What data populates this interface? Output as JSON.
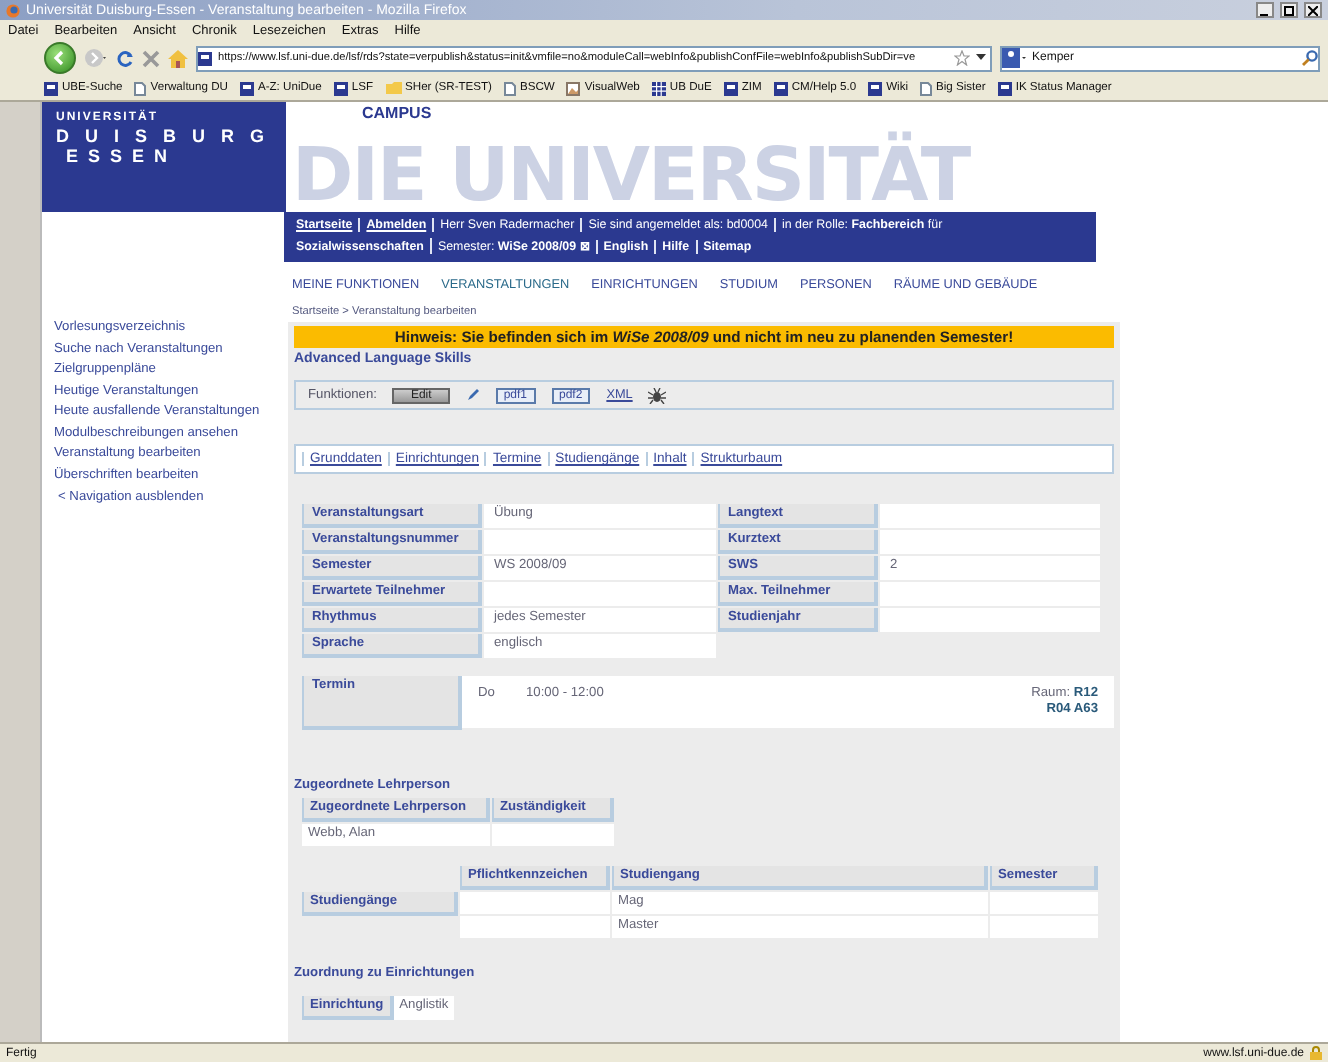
{
  "browser": {
    "title": "Universität Duisburg-Essen - Veranstaltung bearbeiten - Mozilla Firefox",
    "menu": [
      "Datei",
      "Bearbeiten",
      "Ansicht",
      "Chronik",
      "Lesezeichen",
      "Extras",
      "Hilfe"
    ],
    "url": "https://www.lsf.uni-due.de/lsf/rds?state=verpublish&status=init&vmfile=no&moduleCall=webInfo&publishConfFile=webInfo&publishSubDir=ve",
    "search_value": "Kemper",
    "bookmarks": [
      {
        "label": "UBE-Suche",
        "kind": "site"
      },
      {
        "label": "Verwaltung DU",
        "kind": "page"
      },
      {
        "label": "A-Z: UniDue",
        "kind": "site"
      },
      {
        "label": "LSF",
        "kind": "site"
      },
      {
        "label": "SHer (SR-TEST)",
        "kind": "folder"
      },
      {
        "label": "BSCW",
        "kind": "page"
      },
      {
        "label": "VisualWeb",
        "kind": "image"
      },
      {
        "label": "UB DuE",
        "kind": "grid"
      },
      {
        "label": "ZIM",
        "kind": "site"
      },
      {
        "label": "CM/Help 5.0",
        "kind": "site"
      },
      {
        "label": "Wiki",
        "kind": "site"
      },
      {
        "label": "Big Sister",
        "kind": "page"
      },
      {
        "label": "IK Status Manager",
        "kind": "site"
      }
    ]
  },
  "header": {
    "logo_top": "UNIVERSITÄT",
    "logo_city1": "DUISBURG",
    "logo_city2": "ESSEN",
    "watermark": "DIE UNIVERSITÄT",
    "portal": "CAMPUS"
  },
  "userbar": [
    [
      {
        "text": "Startseite",
        "kind": "link"
      },
      {
        "text": "Abmelden",
        "kind": "link"
      },
      {
        "text": "Herr Sven Radermacher",
        "kind": "text"
      },
      {
        "text": "Sie sind angemeldet als:    bd0004",
        "kind": "text"
      },
      {
        "text": "in der Rolle: **Fachbereich** für",
        "kind": "text"
      }
    ],
    [
      {
        "text": "Sozialwissenschaften",
        "kind": "bold"
      },
      {
        "text": "Semester:  **WiSe 2008/09 ⊠**",
        "kind": "text"
      },
      {
        "text": "English",
        "kind": "bold"
      },
      {
        "text": "Hilfe",
        "kind": "bold"
      },
      {
        "text": "Sitemap",
        "kind": "bold"
      }
    ]
  ],
  "main_nav": [
    {
      "label": "MEINE FUNKTIONEN",
      "selected": false
    },
    {
      "label": "VERANSTALTUNGEN",
      "selected": true
    },
    {
      "label": "EINRICHTUNGEN",
      "selected": false
    },
    {
      "label": "STUDIUM",
      "selected": false
    },
    {
      "label": "PERSONEN",
      "selected": false
    },
    {
      "label": "RÄUME UND GEBÄUDE",
      "selected": false
    }
  ],
  "sidebar": {
    "items": [
      "Vorlesungsverzeichnis",
      "Suche nach Veranstaltungen",
      "Zielgruppenpläne",
      "Heutige Veranstaltungen",
      "Heute ausfallende Veranstaltungen",
      "Modulbeschreibungen ansehen",
      "Veranstaltung bearbeiten",
      "Überschriften bearbeiten"
    ],
    "hide_link": "< Navigation ausblenden"
  },
  "breadcrumb": "Startseite > Veranstaltung bearbeiten",
  "notice": "Hinweis: Sie befinden sich im *WiSe 2008/09* und nicht im neu zu planenden Semester!",
  "course_title": "Advanced Language Skills",
  "functions": {
    "label": "Funktionen:",
    "items": [
      {
        "kind": "button",
        "label": "Edit"
      },
      {
        "kind": "pen"
      },
      {
        "kind": "boxed",
        "label": "pdf1"
      },
      {
        "kind": "boxed",
        "label": "pdf2"
      },
      {
        "kind": "link",
        "label": "XML"
      },
      {
        "kind": "bug"
      }
    ]
  },
  "tabs": [
    "Grunddaten",
    "Einrichtungen",
    "Termine",
    "Studiengänge",
    "Inhalt",
    "Strukturbaum"
  ],
  "details": [
    {
      "label": "Veranstaltungsart",
      "value": "Übung",
      "label2": "Langtext"
    },
    {
      "label": "Veranstaltungsnummer",
      "label2": "Kurztext"
    },
    {
      "label": "Semester",
      "value": "WS 2008/09",
      "label2": "SWS",
      "value2": "2"
    },
    {
      "label": "Erwartete Teilnehmer",
      "label2": "Max. Teilnehmer"
    },
    {
      "label": "Rhythmus",
      "value": "jedes Semester",
      "label2": "Studienjahr"
    },
    {
      "label": "Sprache",
      "value": "englisch"
    }
  ],
  "termin": {
    "label": "Termin",
    "day": "Do",
    "time": "10:00 - 12:00",
    "room_label": "Raum:",
    "room": "R12 R04 A63"
  },
  "lecturers": {
    "heading": "Zugeordnete Lehrperson",
    "columns": [
      "Zugeordnete Lehrperson",
      "Zuständigkeit"
    ],
    "rows": [
      {
        "name": "Webb, Alan"
      }
    ]
  },
  "programs": {
    "label": "Studiengänge",
    "columns": [
      "Pflichtkennzeichen",
      "Studiengang",
      "Semester"
    ],
    "rows": [
      {
        "studiengang": "Mag"
      },
      {
        "studiengang": "Master"
      }
    ]
  },
  "institutions": {
    "heading": "Zuordnung zu Einrichtungen",
    "label": "Einrichtung",
    "value": "Anglistik"
  },
  "status_bar": {
    "text": "Fertig",
    "domain": "www.lsf.uni-due.de"
  }
}
